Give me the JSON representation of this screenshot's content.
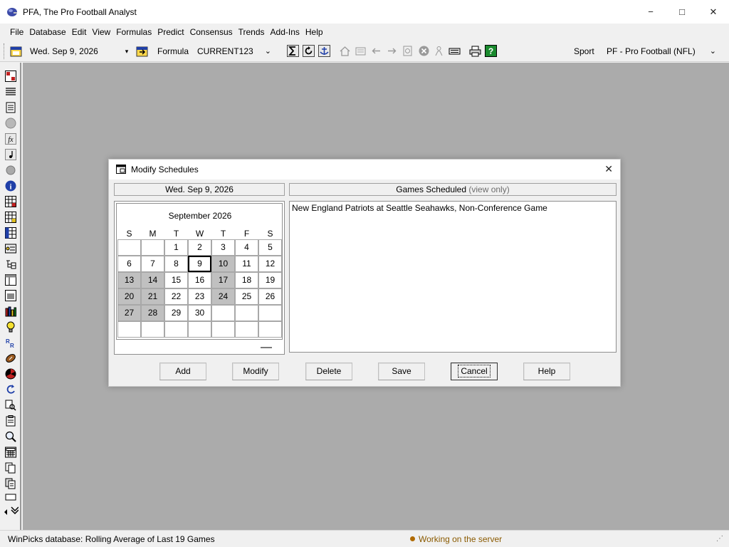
{
  "window": {
    "title": "PFA, The Pro Football Analyst"
  },
  "window_controls": {
    "minimize": "−",
    "maximize": "□",
    "close": "✕"
  },
  "menu": [
    "File",
    "Database",
    "Edit",
    "View",
    "Formulas",
    "Predict",
    "Consensus",
    "Trends",
    "Add-Ins",
    "Help"
  ],
  "toolbar": {
    "date": "Wed. Sep  9, 2026",
    "formula_label": "Formula",
    "formula_value": "CURRENT123",
    "sport_label": "Sport",
    "sport_value": "PF - Pro Football (NFL)"
  },
  "dialog": {
    "title": "Modify Schedules",
    "close": "✕",
    "date_header": "Wed. Sep  9, 2026",
    "games_header": "Games Scheduled",
    "games_header_note": "(view only)",
    "games": [
      "New England Patriots at Seattle Seahawks, Non-Conference Game"
    ],
    "buttons": {
      "add": "Add",
      "modify": "Modify",
      "delete": "Delete",
      "save": "Save",
      "cancel": "Cancel",
      "help": "Help"
    }
  },
  "calendar": {
    "month_label": "September 2026",
    "weekdays": [
      "S",
      "M",
      "T",
      "W",
      "T",
      "F",
      "S"
    ],
    "weeks": [
      [
        "",
        "",
        "1",
        "2",
        "3",
        "4",
        "5"
      ],
      [
        "6",
        "7",
        "8",
        "9",
        "10",
        "11",
        "12"
      ],
      [
        "13",
        "14",
        "15",
        "16",
        "17",
        "18",
        "19"
      ],
      [
        "20",
        "21",
        "22",
        "23",
        "24",
        "25",
        "26"
      ],
      [
        "27",
        "28",
        "29",
        "30",
        "",
        "",
        ""
      ],
      [
        "",
        "",
        "",
        "",
        "",
        "",
        ""
      ]
    ],
    "shaded_days": [
      "10",
      "13",
      "14",
      "17",
      "20",
      "21",
      "24",
      "27",
      "28"
    ],
    "selected_day": "9"
  },
  "status": {
    "database": "WinPicks database:  Rolling Average of Last 19 Games",
    "working": "Working on the server"
  },
  "colors": {
    "workspace": "#ababab",
    "shaded_day": "#c0c0c0",
    "status_working": "#8a5a00"
  }
}
